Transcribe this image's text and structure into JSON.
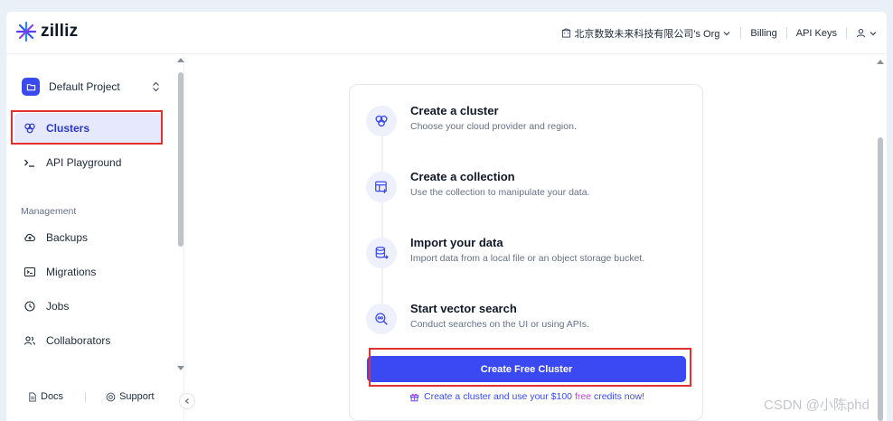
{
  "app": {
    "logo_text": "zilliz"
  },
  "topnav": {
    "org_label": "北京数致未来科技有限公司's Org",
    "billing_label": "Billing",
    "api_keys_label": "API Keys"
  },
  "sidebar": {
    "project_label": "Default Project",
    "items": [
      {
        "label": "Clusters",
        "icon": "clusters-icon",
        "active": true
      },
      {
        "label": "API Playground",
        "icon": "terminal-icon"
      }
    ],
    "section_label": "Management",
    "management_items": [
      {
        "label": "Backups",
        "icon": "cloud-backup-icon"
      },
      {
        "label": "Migrations",
        "icon": "migration-icon"
      },
      {
        "label": "Jobs",
        "icon": "clock-icon"
      },
      {
        "label": "Collaborators",
        "icon": "users-icon"
      }
    ],
    "footer": {
      "docs_label": "Docs",
      "support_label": "Support"
    }
  },
  "onboarding": {
    "steps": [
      {
        "title": "Create a cluster",
        "desc": "Choose your cloud provider and region.",
        "icon": "clusters-icon"
      },
      {
        "title": "Create a collection",
        "desc": "Use the collection to manipulate your data.",
        "icon": "table-add-icon"
      },
      {
        "title": "Import your data",
        "desc": "Import data from a local file or an object storage bucket.",
        "icon": "database-import-icon"
      },
      {
        "title": "Start vector search",
        "desc": "Conduct searches on the UI or using APIs.",
        "icon": "vector-search-icon"
      }
    ],
    "cta_label": "Create Free Cluster",
    "promo_prefix": "Create a cluster and use your $100",
    "promo_free": "free",
    "promo_suffix": "credits now!"
  },
  "watermark": "CSDN @小陈phd",
  "colors": {
    "accent": "#3a49f2",
    "highlight": "#e0312f",
    "active_bg": "#e6e9fe"
  }
}
